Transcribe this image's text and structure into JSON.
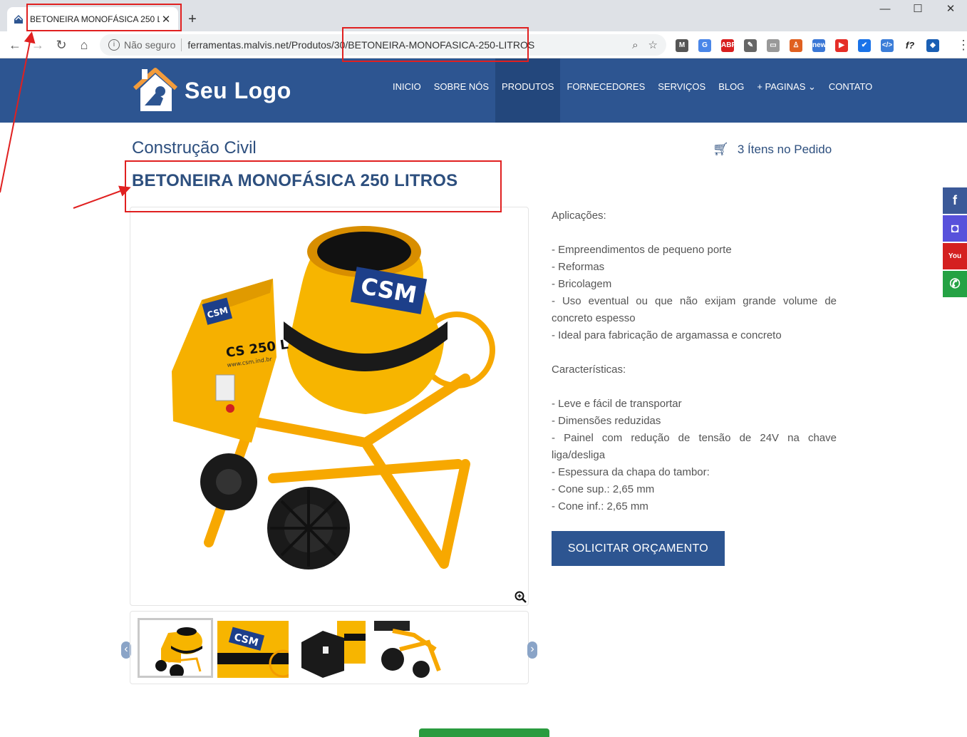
{
  "browser": {
    "tab_title": "BETONEIRA MONOFÁSICA 250 LI",
    "tab_close": "✕",
    "new_tab": "+",
    "security_label": "Não seguro",
    "url": "ferramentas.malvis.net/Produtos/30/BETONEIRA-MONOFASICA-250-LITROS",
    "window_controls": [
      "—",
      "☐",
      "✕"
    ],
    "extensions": [
      {
        "name": "gmail-extension-icon",
        "label": "M",
        "color": "#555555"
      },
      {
        "name": "translate-extension-icon",
        "label": "G",
        "color": "#4a86e8"
      },
      {
        "name": "adblock-extension-icon",
        "label": "ABP",
        "color": "#d81f1f"
      },
      {
        "name": "eyedropper-extension-icon",
        "label": "✎",
        "color": "#666666"
      },
      {
        "name": "screen-extension-icon",
        "label": "▭",
        "color": "#999999"
      },
      {
        "name": "person-extension-icon",
        "label": "♙",
        "color": "#e06020"
      },
      {
        "name": "new-extension-icon",
        "label": "new",
        "color": "#3a77d6"
      },
      {
        "name": "youtube-extension-icon",
        "label": "▶",
        "color": "#e52d27"
      },
      {
        "name": "check-extension-icon",
        "label": "✔",
        "color": "#1a73e8"
      },
      {
        "name": "code-extension-icon",
        "label": "</>",
        "color": "#3b7dd8"
      },
      {
        "name": "fx-extension-icon",
        "label": "f?",
        "color": "#ffffff"
      },
      {
        "name": "profile-extension-icon",
        "label": "◆",
        "color": "#1a5fb4"
      }
    ]
  },
  "header": {
    "logo_text": "Seu Logo",
    "menu": [
      {
        "label": "INICIO",
        "active": false
      },
      {
        "label": "SOBRE NÓS",
        "active": false
      },
      {
        "label": "PRODUTOS",
        "active": true
      },
      {
        "label": "FORNECEDORES",
        "active": false
      },
      {
        "label": "SERVIÇOS",
        "active": false
      },
      {
        "label": "BLOG",
        "active": false
      },
      {
        "label": "+ PAGINAS ⌄",
        "active": false
      },
      {
        "label": "CONTATO",
        "active": false
      }
    ]
  },
  "page": {
    "category": "Construção Civil",
    "cart_text": "3 Ítens no Pedido",
    "product_title": "BETONEIRA MONOFÁSICA 250 LITROS",
    "image_brand": "CSM",
    "image_model": "CS 250 L",
    "image_site": "www.csm.ind.br",
    "description": [
      "Aplicações:",
      "",
      "- Empreendimentos de pequeno porte",
      "- Reformas",
      "- Bricolagem",
      "- Uso eventual ou que não exijam grande volume de concreto espesso",
      "- Ideal para fabricação de argamassa e concreto",
      "",
      "Características:",
      "",
      "- Leve e fácil de transportar",
      "- Dimensões reduzidas",
      "- Painel com redução de tensão de 24V na chave liga/desliga",
      "- Espessura da chapa do tambor:",
      "- Cone sup.: 2,65 mm",
      "- Cone inf.: 2,65 mm"
    ],
    "quote_button": "SOLICITAR ORÇAMENTO",
    "thumb_brand": "CSM"
  },
  "social": [
    {
      "name": "facebook-icon",
      "label": "f",
      "color": "#3b5998"
    },
    {
      "name": "instagram-icon",
      "label": "◘",
      "color": "#5851db"
    },
    {
      "name": "youtube-icon",
      "label": "You",
      "color": "#d42020"
    },
    {
      "name": "whatsapp-icon",
      "label": "✆",
      "color": "#25a244"
    }
  ],
  "colors": {
    "header_bg": "#2d5591",
    "accent": "#2d4f7e",
    "annotation": "#e02020",
    "mixer_yellow": "#f7b500"
  }
}
